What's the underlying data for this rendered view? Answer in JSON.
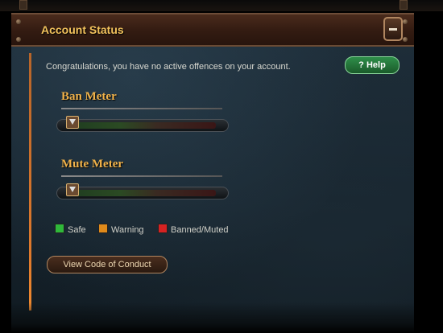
{
  "panel": {
    "title": "Account Status",
    "collapse_icon": "minus-icon"
  },
  "status": {
    "message": "Congratulations, you have no active offences on your account."
  },
  "help": {
    "icon": "question-icon",
    "label": "Help"
  },
  "meters": {
    "ban": {
      "label": "Ban Meter",
      "level": 0
    },
    "mute": {
      "label": "Mute Meter",
      "level": 0
    }
  },
  "legend": [
    {
      "label": "Safe",
      "color": "#2fb83a"
    },
    {
      "label": "Warning",
      "color": "#e08a1a"
    },
    {
      "label": "Banned/Muted",
      "color": "#d62222"
    }
  ],
  "conduct": {
    "label": "View Code of Conduct"
  },
  "colors": {
    "title": "#f2c25c",
    "accent": "#f0b24a"
  }
}
